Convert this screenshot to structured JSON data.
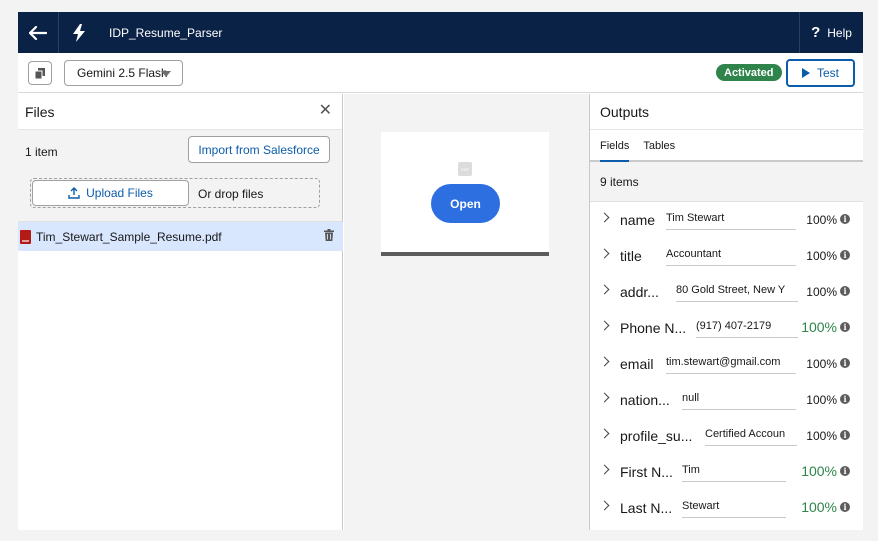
{
  "app": {
    "title": "IDP_Resume_Parser",
    "help_label": "Help"
  },
  "toolbar": {
    "model": "Gemini 2.5 Flash",
    "status": "Activated",
    "test_label": "Test"
  },
  "files": {
    "title": "Files",
    "count": "1 item",
    "import_label": "Import from Salesforce",
    "upload_label": "Upload Files",
    "drop_label": "Or drop files",
    "items": [
      {
        "name": "Tim_Stewart_Sample_Resume.pdf"
      }
    ]
  },
  "preview": {
    "open_label": "Open",
    "pdf_label": "PDF"
  },
  "outputs": {
    "title": "Outputs",
    "tabs": [
      "Fields",
      "Tables"
    ],
    "active_tab": "Fields",
    "count": "9 items",
    "fields": [
      {
        "name": "name",
        "value": "Tim Stewart",
        "confidence": "100%",
        "highlight": false
      },
      {
        "name": "title",
        "value": "Accountant",
        "confidence": "100%",
        "highlight": false
      },
      {
        "name": "addr...",
        "value": "80 Gold Street, New Y",
        "confidence": "100%",
        "highlight": false
      },
      {
        "name": "Phone N...",
        "value": "(917) 407-2179",
        "confidence": "100%",
        "highlight": true
      },
      {
        "name": "email",
        "value": "tim.stewart@gmail.com",
        "confidence": "100%",
        "highlight": false
      },
      {
        "name": "nation...",
        "value": "null",
        "confidence": "100%",
        "highlight": false
      },
      {
        "name": "profile_su...",
        "value": "Certified Accoun",
        "confidence": "100%",
        "highlight": false
      },
      {
        "name": "First N...",
        "value": "Tim",
        "confidence": "100%",
        "highlight": true
      },
      {
        "name": "Last N...",
        "value": "Stewart",
        "confidence": "100%",
        "highlight": true
      }
    ]
  },
  "colors": {
    "topbar": "#0b2247",
    "brand": "#0b5cab",
    "success": "#2e844a",
    "selected_row": "#d8e6fe"
  }
}
